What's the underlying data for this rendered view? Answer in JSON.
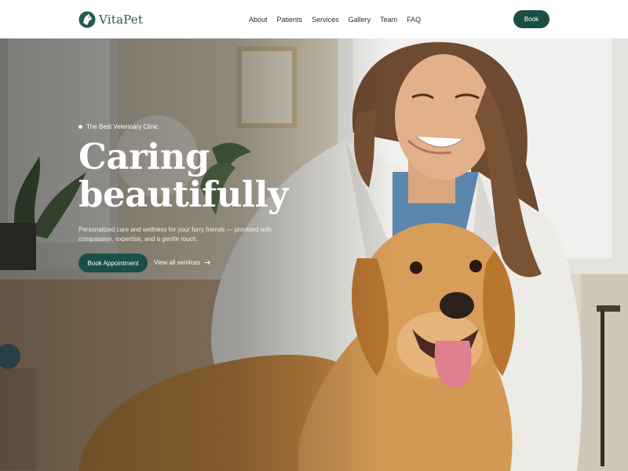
{
  "brand": {
    "name": "VitaPet",
    "accent": "#1a4f47",
    "logo_icon": "pet-head-icon"
  },
  "nav": {
    "items": [
      {
        "label": "About"
      },
      {
        "label": "Patients"
      },
      {
        "label": "Services"
      },
      {
        "label": "Gallery"
      },
      {
        "label": "Team"
      },
      {
        "label": "FAQ"
      }
    ]
  },
  "header": {
    "book_label": "Book"
  },
  "hero": {
    "badge": "The Best Veterinary Clinic",
    "headline_line1": "Caring",
    "headline_line2": "beautifully",
    "subtext": "Personalized care and wellness for your furry friends — provided with compassion, expertise, and a gentle touch.",
    "primary_cta": "Book Appointment",
    "secondary_cta": "View all services",
    "secondary_cta_icon": "arrow-right-icon"
  }
}
